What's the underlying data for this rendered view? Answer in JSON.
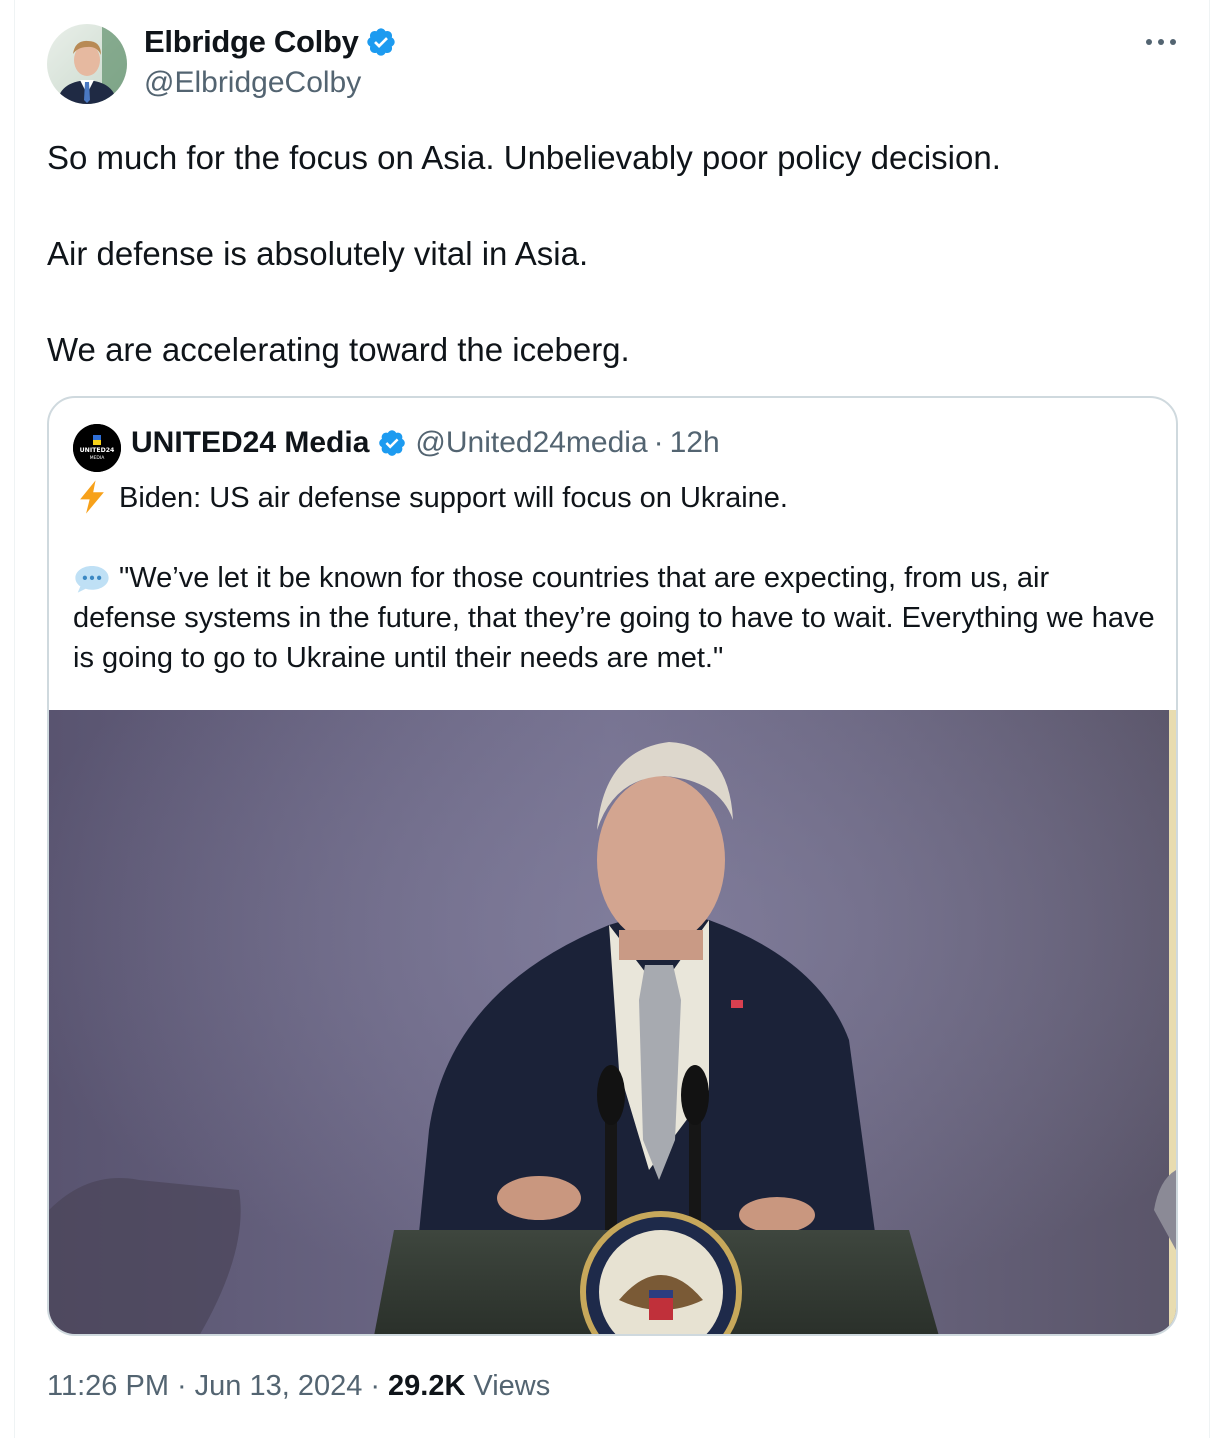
{
  "author": {
    "name": "Elbridge Colby",
    "handle": "@ElbridgeColby",
    "verified": true
  },
  "tweet": {
    "paragraphs": [
      "So much for the focus on Asia. Unbelievably poor policy decision.",
      "Air defense is absolutely vital in Asia.",
      "We are accelerating toward the iceberg."
    ]
  },
  "quote": {
    "name": "UNITED24 Media",
    "handle": "@United24media",
    "separator": "·",
    "time": "12h",
    "avatar_text": "UNITED24",
    "avatar_subtext": "MEDIA",
    "line1": "Biden: US air defense support will focus on Ukraine.",
    "line2": "\"We’ve let it be known for those countries that are expecting, from us, air defense systems in the future, that they’re going to have to wait. Everything we have is going to go to Ukraine until their needs are met.\"",
    "line1_icon": "lightning-bolt-emoji",
    "line2_icon": "speech-bubble-emoji"
  },
  "meta": {
    "time": "11:26 PM",
    "date": "Jun 13, 2024",
    "separator": "·",
    "views_count": "29.2K",
    "views_label": "Views"
  },
  "colors": {
    "text": "#0f1419",
    "secondary": "#536471",
    "verified": "#1d9bf0",
    "border": "#cfd9de"
  }
}
